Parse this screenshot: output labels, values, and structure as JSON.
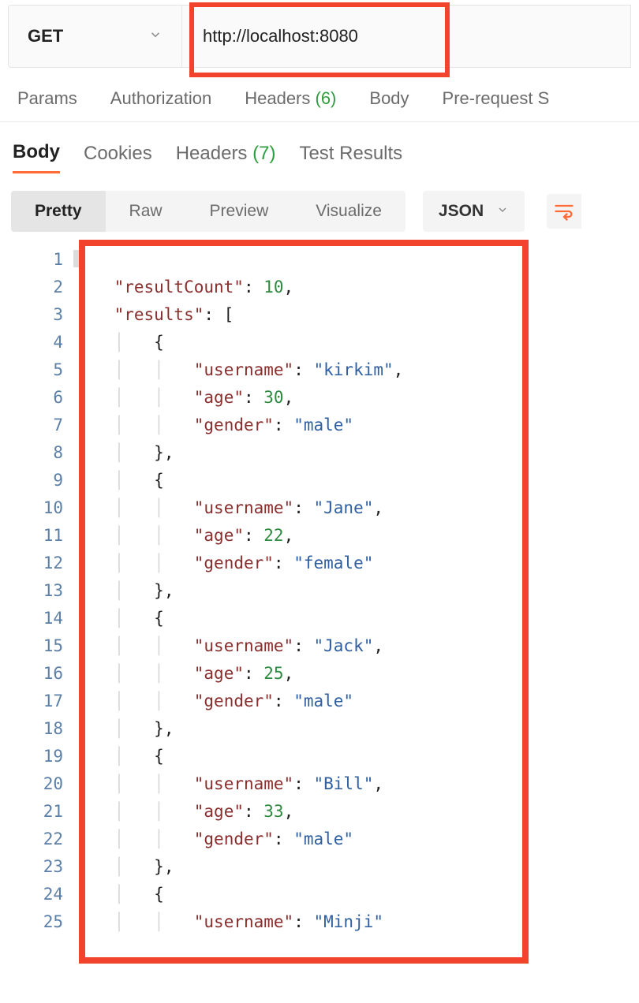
{
  "request": {
    "method": "GET",
    "url": "http://localhost:8080"
  },
  "request_tabs": {
    "params": "Params",
    "authorization": "Authorization",
    "headers": "Headers",
    "headers_count": "(6)",
    "body": "Body",
    "prerequest": "Pre-request S"
  },
  "response_tabs": {
    "body": "Body",
    "cookies": "Cookies",
    "headers": "Headers",
    "headers_count": "(7)",
    "test_results": "Test Results"
  },
  "view_modes": {
    "pretty": "Pretty",
    "raw": "Raw",
    "preview": "Preview",
    "visualize": "Visualize",
    "format": "JSON"
  },
  "response_body": {
    "resultCount": 10,
    "results": [
      {
        "username": "kirkim",
        "age": 30,
        "gender": "male"
      },
      {
        "username": "Jane",
        "age": 22,
        "gender": "female"
      },
      {
        "username": "Jack",
        "age": 25,
        "gender": "male"
      },
      {
        "username": "Bill",
        "age": 33,
        "gender": "male"
      },
      {
        "username": "Minji"
      }
    ]
  },
  "line_count": 25
}
